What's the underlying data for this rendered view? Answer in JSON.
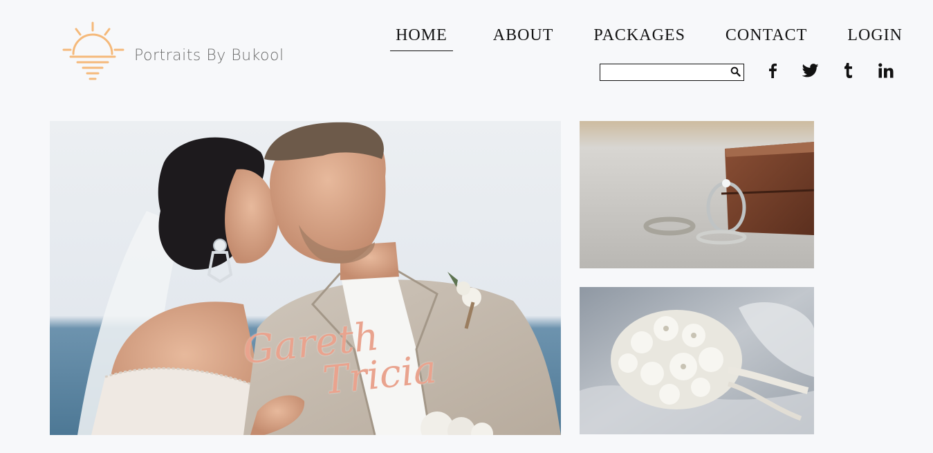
{
  "brand": {
    "name": "Portraits By Bukool",
    "logo_icon": "sunset-logo-icon",
    "accent": "#f5b97a"
  },
  "nav": {
    "items": [
      {
        "label": "HOME",
        "active": true
      },
      {
        "label": "ABOUT",
        "active": false
      },
      {
        "label": "PACKAGES",
        "active": false
      },
      {
        "label": "CONTACT",
        "active": false
      },
      {
        "label": "LOGIN",
        "active": false
      }
    ]
  },
  "search": {
    "value": "",
    "placeholder": "",
    "icon": "search-icon"
  },
  "social": {
    "icons": [
      "facebook-icon",
      "twitter-icon",
      "tumblr-icon",
      "linkedin-icon"
    ]
  },
  "gallery": {
    "hero": {
      "image": "bride-and-groom-photo",
      "names": [
        "Gareth",
        "Tricia"
      ],
      "names_color": "#e9a38e"
    },
    "thumbs": [
      {
        "image": "wedding-rings-photo"
      },
      {
        "image": "bridal-bouquet-photo"
      }
    ]
  }
}
